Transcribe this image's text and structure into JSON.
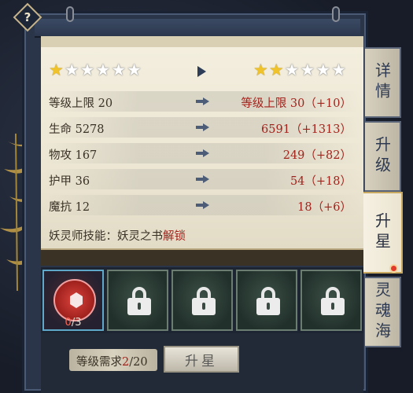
{
  "help_label": "?",
  "star_change": {
    "current": {
      "filled": 1,
      "total": 6
    },
    "next": {
      "filled": 2,
      "total": 6
    }
  },
  "stats": [
    {
      "label": "等级上限",
      "current": "20",
      "next": "等级上限 30（+10）"
    },
    {
      "label": "生命",
      "current": "5278",
      "next": "6591（+1313）"
    },
    {
      "label": "物攻",
      "current": "167",
      "next": "249（+82）"
    },
    {
      "label": "护甲",
      "current": "36",
      "next": "54（+18）"
    },
    {
      "label": "魔抗",
      "current": "12",
      "next": "18（+6）"
    }
  ],
  "skill_unlock": {
    "prefix": "妖灵师技能：妖灵之书",
    "action": "解锁"
  },
  "tabs": [
    {
      "label": "详情"
    },
    {
      "label": "升级"
    },
    {
      "label": "升星",
      "active": true
    },
    {
      "label": "灵魂海",
      "badge": true
    }
  ],
  "material_slots": {
    "active": {
      "count": "0",
      "total": "/3"
    },
    "locked_count": 4
  },
  "requirement": {
    "label": "等级需求",
    "current": "2",
    "total": "/20"
  },
  "upgrade_button": "升星",
  "colors": {
    "accent_red": "#a2231c",
    "star_gold": "#f0c32b",
    "frame_navy": "#2a3549"
  }
}
